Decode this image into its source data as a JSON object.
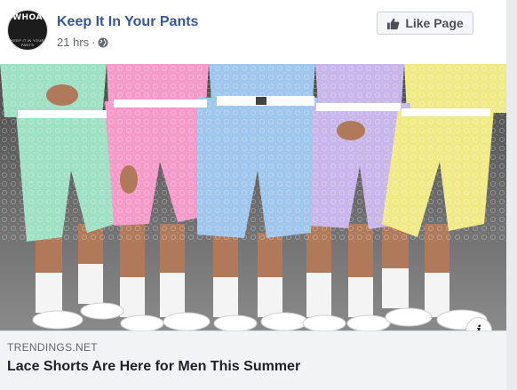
{
  "post": {
    "page_name": "Keep It In Your Pants",
    "timestamp": "21 hrs",
    "separator": "·",
    "avatar": {
      "text": "WHOA",
      "subtext": "KEEP IT IN YOUR PANTS"
    },
    "like_button_label": "Like Page",
    "info_label": "i"
  },
  "link_preview": {
    "domain": "TRENDINGS.NET",
    "title": "Lace Shorts Are Here for Men This Summer"
  },
  "icons": {
    "globe": "globe-icon",
    "like": "thumbs-up-icon",
    "info": "info-icon"
  },
  "colors": {
    "page_name": "#385898",
    "shorts": [
      "#9ee0c4",
      "#f49ac8",
      "#9fc6ec",
      "#c8b6ea",
      "#f0ea86"
    ],
    "photo_background": "#6a6a6a"
  }
}
